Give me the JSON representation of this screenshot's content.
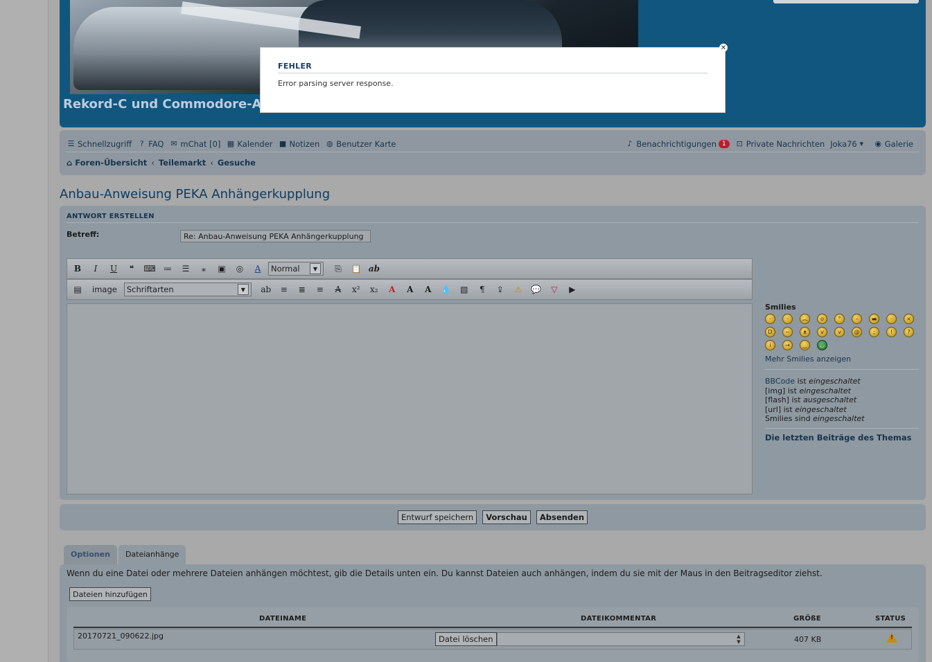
{
  "header": {
    "site_title": "Rekord-C und Commodore-A F"
  },
  "nav": {
    "items": [
      {
        "icon": "menu-icon",
        "label": "Schnellzugriff"
      },
      {
        "icon": "help-icon",
        "label": "FAQ"
      },
      {
        "icon": "chat-icon",
        "label": "mChat [0]"
      },
      {
        "icon": "calendar-icon",
        "label": "Kalender"
      },
      {
        "icon": "notes-icon",
        "label": "Notizen"
      },
      {
        "icon": "globe-icon",
        "label": "Benutzer Karte"
      }
    ],
    "right": {
      "notifications_label": "Benachrichtigungen",
      "notifications_count": "1",
      "pm_label": "Private Nachrichten",
      "user": "Joka76",
      "gallery_label": "Galerie"
    },
    "breadcrumbs": [
      "Foren-Übersicht",
      "Teilemarkt",
      "Gesuche"
    ]
  },
  "topic_title": "Anbau-Anweisung PEKA Anhängerkupplung",
  "post": {
    "section_title": "ANTWORT ERSTELLEN",
    "subject_label": "Betreff:",
    "subject_value": "Re: Anbau-Anweisung PEKA Anhängerkupplung",
    "toolbar": {
      "bold": "B",
      "italic": "I",
      "underline": "U",
      "size_select": "Normal",
      "image_label": "image",
      "font_select": "Schriftarten"
    },
    "smilies_title": "Smilies",
    "more_smilies": "Mehr Smilies anzeigen",
    "rules": {
      "bbcode_link": "BBCode",
      "bbcode_text": "ist",
      "bbcode_state": "eingeschaltet",
      "img": "[img] ist",
      "img_state": "eingeschaltet",
      "flash": "[flash] ist",
      "flash_state": "ausgeschaltet",
      "url": "[url] ist",
      "url_state": "eingeschaltet",
      "smilies": "Smilies sind",
      "smilies_state": "eingeschaltet"
    },
    "last_posts": "Die letzten Beiträge des Themas"
  },
  "actions": {
    "draft": "Entwurf speichern",
    "preview": "Vorschau",
    "submit": "Absenden"
  },
  "tabs": [
    "Optionen",
    "Dateianhänge"
  ],
  "attachments": {
    "info": "Wenn du eine Datei oder mehrere Dateien anhängen möchtest, gib die Details unten ein. Du kannst Dateien auch anhängen, indem du sie mit der Maus in den Beitragseditor ziehst.",
    "add_button": "Dateien hinzufügen",
    "headers": {
      "name": "DATEINAME",
      "comment": "DATEIKOMMENTAR",
      "size": "GRÖßE",
      "status": "STATUS"
    },
    "rows": [
      {
        "name": "20170721_090622.jpg",
        "delete": "Datei löschen",
        "size": "407 KB",
        "status_icon": "warning-icon"
      }
    ]
  },
  "modal": {
    "title": "FEHLER",
    "message": "Error parsing server response."
  }
}
